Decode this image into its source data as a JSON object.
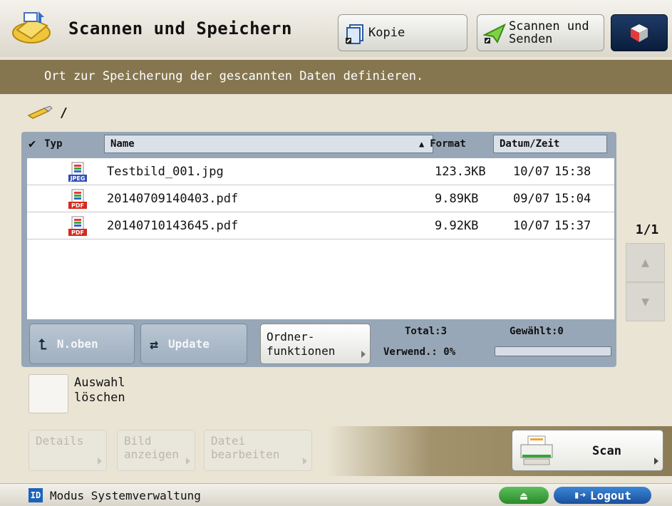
{
  "header": {
    "title": "Scannen und Speichern",
    "kopie_label": "Kopie",
    "senden_label_1": "Scannen und",
    "senden_label_2": "Senden"
  },
  "banner": {
    "text": "Ort zur Speicherung der gescannten Daten definieren."
  },
  "location": {
    "path": "/"
  },
  "file_list": {
    "columns": {
      "type": "Typ",
      "name": "Name",
      "format": "Format",
      "datetime": "Datum/Zeit"
    },
    "sort_indicator": "▲",
    "rows": [
      {
        "icon": "jpeg-file-icon",
        "badge": "JPEG",
        "name": "Testbild_001.jpg",
        "size": "123.3KB",
        "date": "10/07",
        "time": "15:38"
      },
      {
        "icon": "pdf-file-icon",
        "badge": "PDF",
        "name": "20140709140403.pdf",
        "size": "9.89KB",
        "date": "09/07",
        "time": "15:04"
      },
      {
        "icon": "pdf-file-icon",
        "badge": "PDF",
        "name": "20140710143645.pdf",
        "size": "9.92KB",
        "date": "10/07",
        "time": "15:37"
      }
    ]
  },
  "panel_buttons": {
    "up_label": "N.oben",
    "update_label": "Update",
    "folder_label_1": "Ordner-",
    "folder_label_2": "funktionen"
  },
  "stats": {
    "total_label": "Total:3",
    "selected_label": "Gewählt:0",
    "used_label": "Verwend.: 0%",
    "usage_fraction": 0
  },
  "pager": {
    "text": "1/1",
    "up_icon": "▲",
    "down_icon": "▼"
  },
  "clear_selection": {
    "line1": "Auswahl",
    "line2": "löschen"
  },
  "actions": {
    "details": "Details",
    "show_image_1": "Bild",
    "show_image_2": "anzeigen",
    "edit_file_1": "Datei",
    "edit_file_2": "bearbeiten",
    "scan": "Scan"
  },
  "status_bar": {
    "id_badge": "ID",
    "mode": "Modus Systemverwaltung",
    "eject_icon": "⏏",
    "logout": "Logout"
  },
  "colors": {
    "banner": "#857650",
    "panel": "#97a7b7",
    "accent_blue": "#1c63b8",
    "eject_green": "#3aa23a"
  }
}
